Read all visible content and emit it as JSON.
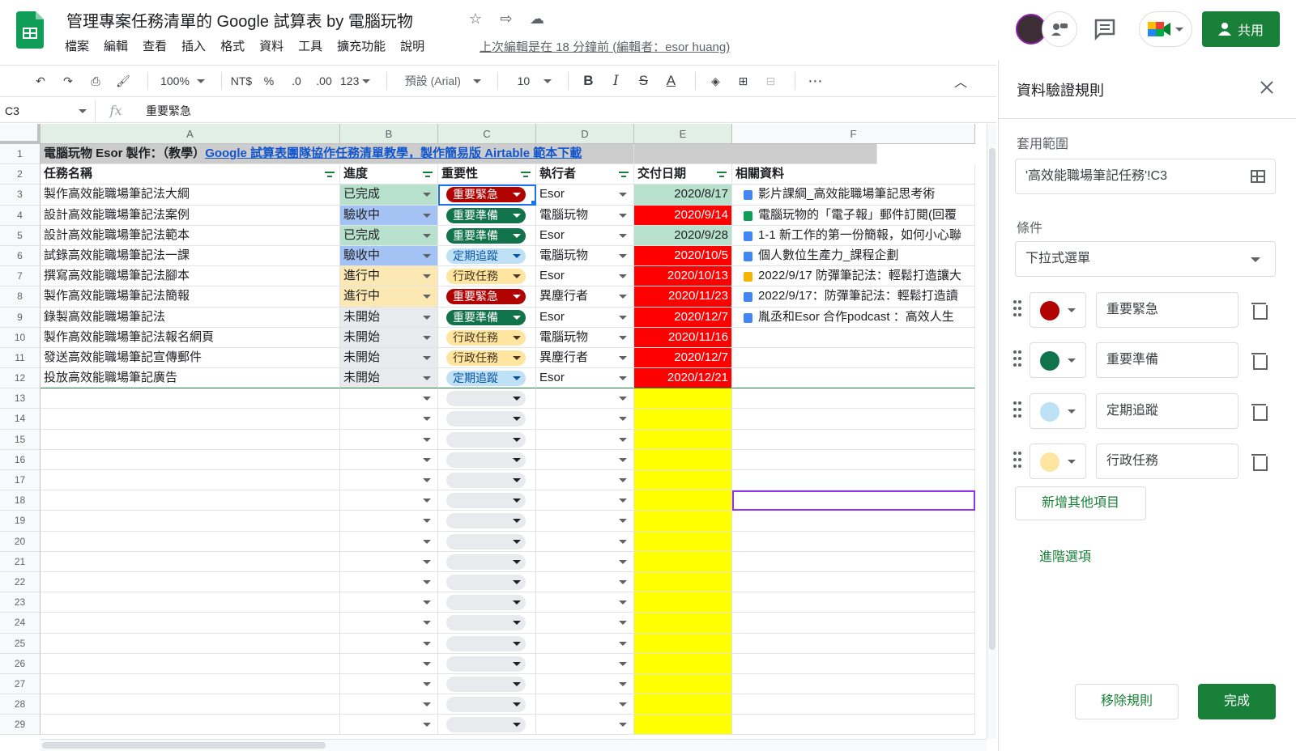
{
  "header": {
    "title": "管理專案任務清單的 Google 試算表 by 電腦玩物",
    "menu": [
      "檔案",
      "編輯",
      "查看",
      "插入",
      "格式",
      "資料",
      "工具",
      "擴充功能",
      "說明"
    ],
    "last_edit": "上次編輯是在 18 分鐘前 (編輯者：esor huang)",
    "share_label": "共用"
  },
  "toolbar": {
    "zoom": "100%",
    "currency": "NT$",
    "percent": "%",
    "dec_decrease": ".0",
    "dec_increase": ".00",
    "more_formats": "123",
    "font": "預設 (Arial)",
    "font_size": "10"
  },
  "formula_bar": {
    "name_box": "C3",
    "fx": "fx",
    "value": "重要緊急"
  },
  "columns": [
    "A",
    "B",
    "C",
    "D",
    "E",
    "F"
  ],
  "title_row": {
    "prefix": "電腦玩物 Esor 製作：（教學）",
    "link": "Google 試算表團隊協作任務清單教學，製作簡易版 Airtable 範本下載"
  },
  "headers": [
    "任務名稱",
    "進度",
    "重要性",
    "執行者",
    "交付日期",
    "相關資料"
  ],
  "tasks": [
    {
      "row": "3",
      "name": "製作高效能職場筆記法大綱",
      "progress": "已完成",
      "priority": "重要緊急",
      "owner": "Esor",
      "date": "2020/8/17",
      "ref": "影片課綱_高效能職場筆記思考術",
      "ref_type": "doc"
    },
    {
      "row": "4",
      "name": "設計高效能職場筆記法案例",
      "progress": "驗收中",
      "priority": "重要準備",
      "owner": "電腦玩物",
      "date": "2020/9/14",
      "ref": "電腦玩物的「電子報」郵件訂閱(回覆",
      "ref_type": "sheet"
    },
    {
      "row": "5",
      "name": "設計高效能職場筆記法範本",
      "progress": "已完成",
      "priority": "重要準備",
      "owner": "Esor",
      "date": "2020/9/28",
      "ref": "1-1 新工作的第一份簡報，如何小心聯",
      "ref_type": "doc"
    },
    {
      "row": "6",
      "name": "試錄高效能職場筆記法一課",
      "progress": "驗收中",
      "priority": "定期追蹤",
      "owner": "電腦玩物",
      "date": "2020/10/5",
      "ref": "個人數位生產力_課程企劃",
      "ref_type": "doc"
    },
    {
      "row": "7",
      "name": "撰寫高效能職場筆記法腳本",
      "progress": "進行中",
      "priority": "行政任務",
      "owner": "Esor",
      "date": "2020/10/13",
      "ref": "2022/9/17 防彈筆記法：輕鬆打造讓大",
      "ref_type": "slide"
    },
    {
      "row": "8",
      "name": "製作高效能職場筆記法簡報",
      "progress": "進行中",
      "priority": "重要緊急",
      "owner": "異塵行者",
      "date": "2020/11/23",
      "ref": "2022/9/17：防彈筆記法：輕鬆打造讀",
      "ref_type": "doc"
    },
    {
      "row": "9",
      "name": "錄製高效能職場筆記法",
      "progress": "未開始",
      "priority": "重要準備",
      "owner": "Esor",
      "date": "2020/12/7",
      "ref": "胤丞和Esor 合作podcast ：高效人生",
      "ref_type": "doc"
    },
    {
      "row": "10",
      "name": "製作高效能職場筆記法報名網頁",
      "progress": "未開始",
      "priority": "行政任務",
      "owner": "電腦玩物",
      "date": "2020/11/16",
      "ref": "",
      "ref_type": ""
    },
    {
      "row": "11",
      "name": "發送高效能職場筆記宣傳郵件",
      "progress": "未開始",
      "priority": "行政任務",
      "owner": "異塵行者",
      "date": "2020/12/7",
      "ref": "",
      "ref_type": ""
    },
    {
      "row": "12",
      "name": "投放高效能職場筆記廣告",
      "progress": "未開始",
      "priority": "定期追蹤",
      "owner": "Esor",
      "date": "2020/12/21",
      "ref": "",
      "ref_type": ""
    }
  ],
  "empty_rows": [
    "13",
    "14",
    "15",
    "16",
    "17",
    "18",
    "19",
    "20",
    "21",
    "22",
    "23",
    "24",
    "25",
    "26",
    "27",
    "28",
    "29"
  ],
  "colors": {
    "progress": {
      "已完成": "#b7e1cd",
      "驗收中": "#a4c2f4",
      "進行中": "#fce8b2",
      "未開始": "#e8eaed"
    },
    "priority_bg": {
      "重要緊急": "#b10202",
      "重要準備": "#11734b",
      "定期追蹤": "#bfe1f6",
      "行政任務": "#ffe5a0"
    },
    "priority_fg": {
      "重要緊急": "#ffffff",
      "重要準備": "#ffffff",
      "定期追蹤": "#0a53a8",
      "行政任務": "#473821"
    },
    "date_green": "#b7e1cd",
    "date_red": "#ff0000",
    "empty_date": "#ffff00"
  },
  "panel": {
    "title": "資料驗證規則",
    "range_label": "套用範圍",
    "range_value": "'高效能職場筆記任務'!C3",
    "condition_label": "條件",
    "condition_value": "下拉式選單",
    "options": [
      {
        "label": "重要緊急",
        "color": "#b10202"
      },
      {
        "label": "重要準備",
        "color": "#11734b"
      },
      {
        "label": "定期追蹤",
        "color": "#bfe1f6"
      },
      {
        "label": "行政任務",
        "color": "#ffe5a0"
      }
    ],
    "add_label": "新增其他項目",
    "advanced_label": "進階選項",
    "remove_label": "移除規則",
    "done_label": "完成"
  }
}
